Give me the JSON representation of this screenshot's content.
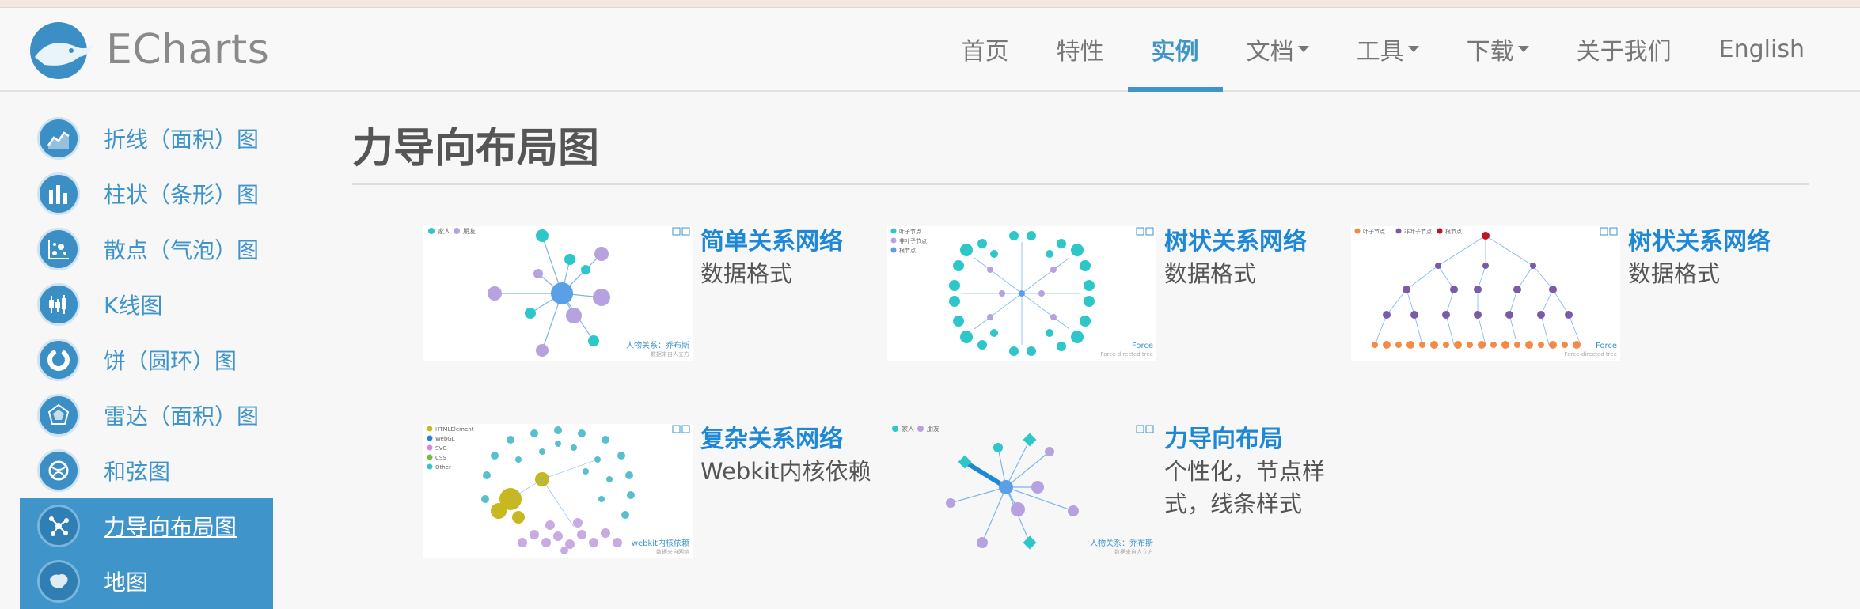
{
  "header": {
    "brand": "ECharts",
    "nav": [
      {
        "label": "首页",
        "dropdown": false,
        "active": false
      },
      {
        "label": "特性",
        "dropdown": false,
        "active": false
      },
      {
        "label": "实例",
        "dropdown": false,
        "active": true
      },
      {
        "label": "文档",
        "dropdown": true,
        "active": false
      },
      {
        "label": "工具",
        "dropdown": true,
        "active": false
      },
      {
        "label": "下载",
        "dropdown": true,
        "active": false
      },
      {
        "label": "关于我们",
        "dropdown": false,
        "active": false
      },
      {
        "label": "English",
        "dropdown": false,
        "active": false
      }
    ]
  },
  "sidebar": {
    "items": [
      {
        "label": "折线（面积）图",
        "icon": "line-chart-icon"
      },
      {
        "label": "柱状（条形）图",
        "icon": "bar-chart-icon"
      },
      {
        "label": "散点（气泡）图",
        "icon": "scatter-chart-icon"
      },
      {
        "label": "K线图",
        "icon": "k-line-icon"
      },
      {
        "label": "饼（圆环）图",
        "icon": "pie-chart-icon"
      },
      {
        "label": "雷达（面积）图",
        "icon": "radar-chart-icon"
      },
      {
        "label": "和弦图",
        "icon": "chord-chart-icon"
      },
      {
        "label": "力导向布局图",
        "icon": "force-graph-icon",
        "active": true
      },
      {
        "label": "地图",
        "icon": "map-icon"
      }
    ]
  },
  "main": {
    "title": "力导向布局图",
    "cards": [
      {
        "title": "简单关系网络",
        "desc": "数据格式",
        "thumb_caption": "人物关系：乔布斯",
        "thumb_sub": "数据来自人立方",
        "legend": [
          "家人",
          "朋友"
        ]
      },
      {
        "title": "树状关系网络",
        "desc": "数据格式",
        "thumb_caption": "Force",
        "thumb_sub": "Force-directed tree",
        "legend": [
          "叶子节点",
          "非叶子节点",
          "根节点"
        ]
      },
      {
        "title": "树状关系网络",
        "desc": "数据格式",
        "thumb_caption": "Force",
        "thumb_sub": "Force-directed tree",
        "legend": [
          "叶子节点",
          "非叶子节点",
          "根节点"
        ]
      },
      {
        "title": "复杂关系网络",
        "desc": "Webkit内核依赖",
        "thumb_caption": "webkit内核依赖",
        "thumb_sub": "数据来自网络",
        "legend": [
          "HTMLElement",
          "WebGL",
          "SVG",
          "CSS",
          "Other"
        ]
      },
      {
        "title": "力导向布局",
        "desc": "个性化，节点样式，线条样式",
        "thumb_caption": "人物关系：乔布斯",
        "thumb_sub": "数据来自人立方",
        "legend": [
          "家人",
          "朋友"
        ]
      }
    ]
  },
  "colors": {
    "accent": "#3f94c9",
    "link": "#1e88d6",
    "teal": "#2ec7c9",
    "purple": "#b6a2de",
    "orange": "#f58a45"
  }
}
